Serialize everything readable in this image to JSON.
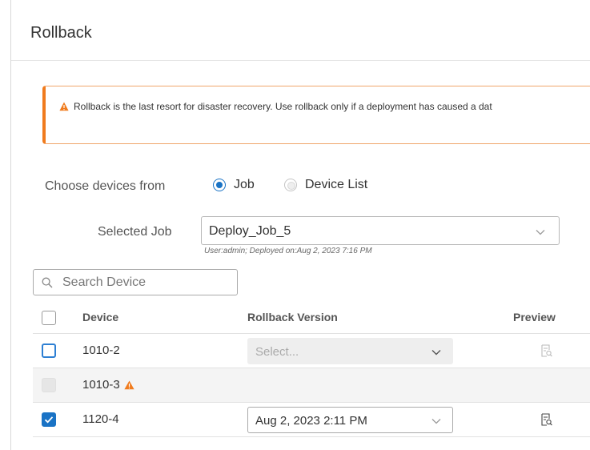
{
  "dialog": {
    "title": "Rollback"
  },
  "alert": {
    "text": "Rollback is the last resort for disaster recovery. Use rollback only if a deployment has caused a dat",
    "color": "#f07b1d"
  },
  "choose": {
    "label": "Choose devices from",
    "options": [
      {
        "label": "Job",
        "selected": true
      },
      {
        "label": "Device List",
        "selected": false
      }
    ]
  },
  "selected_job": {
    "label": "Selected Job",
    "value": "Deploy_Job_5",
    "meta": "User:admin;  Deployed on:Aug 2, 2023 7:16 PM"
  },
  "search": {
    "placeholder": "Search Device"
  },
  "table": {
    "headers": {
      "device": "Device",
      "rollback_version": "Rollback Version",
      "preview": "Preview"
    },
    "rows": [
      {
        "device": "1010-2",
        "version": "Select...",
        "checked": false,
        "state": "focus"
      },
      {
        "device": "1010-3",
        "version": "",
        "checked": false,
        "state": "disabled",
        "warning": true
      },
      {
        "device": "1120-4",
        "version": "Aug 2, 2023 2:11 PM",
        "checked": true,
        "state": "checked"
      }
    ]
  },
  "colors": {
    "accent": "#1a73c5",
    "warning": "#f07b1d"
  }
}
